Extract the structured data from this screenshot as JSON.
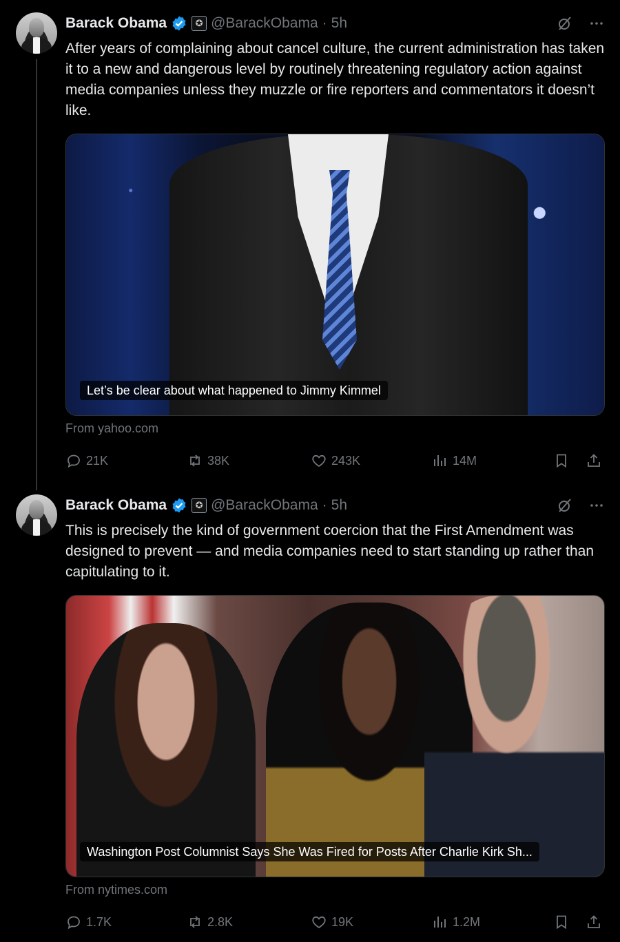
{
  "tweets": [
    {
      "author_name": "Barack Obama",
      "handle": "@BarackObama",
      "separator": "·",
      "time": "5h",
      "text": "After years of complaining about cancel culture, the current administration has taken it to a new and dangerous level by routinely threatening regulatory action against media companies unless they muzzle or fire reporters and commentators it doesn’t like.",
      "card": {
        "caption": "Let’s be clear about what happened to Jimmy Kimmel",
        "source": "From yahoo.com"
      },
      "stats": {
        "replies": "21K",
        "reposts": "38K",
        "likes": "243K",
        "views": "14M"
      }
    },
    {
      "author_name": "Barack Obama",
      "handle": "@BarackObama",
      "separator": "·",
      "time": "5h",
      "text": "This is precisely the kind of government coercion that the First Amendment was designed to prevent — and media companies need to start standing up rather than capitulating to it.",
      "card": {
        "caption": "Washington Post Columnist Says She Was Fired for Posts After Charlie Kirk Sh...",
        "source": "From nytimes.com"
      },
      "stats": {
        "replies": "1.7K",
        "reposts": "2.8K",
        "likes": "19K",
        "views": "1.2M"
      }
    }
  ],
  "colors": {
    "background": "#000000",
    "text": "#e7e9ea",
    "muted": "#71767b",
    "verified": "#1d9bf0",
    "border": "#2f3336"
  },
  "icons": [
    "verified-badge-icon",
    "government-badge-icon",
    "grok-icon",
    "more-icon",
    "reply-icon",
    "repost-icon",
    "like-icon",
    "views-icon",
    "bookmark-icon",
    "share-icon"
  ]
}
